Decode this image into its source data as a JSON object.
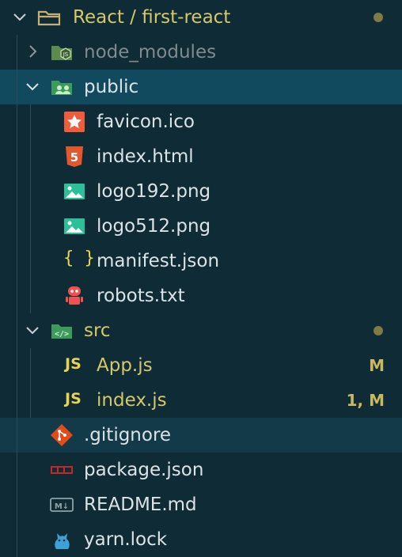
{
  "root": {
    "name": "React / first-react",
    "status": "modified-dot"
  },
  "items": [
    {
      "label": "node_modules",
      "type": "folder",
      "state": "collapsed",
      "style": "ignored"
    },
    {
      "label": "public",
      "type": "folder",
      "state": "expanded",
      "selected": true
    },
    {
      "label": "favicon.ico",
      "type": "file"
    },
    {
      "label": "index.html",
      "type": "file"
    },
    {
      "label": "logo192.png",
      "type": "file"
    },
    {
      "label": "logo512.png",
      "type": "file"
    },
    {
      "label": "manifest.json",
      "type": "file"
    },
    {
      "label": "robots.txt",
      "type": "file"
    },
    {
      "label": "src",
      "type": "folder",
      "state": "expanded",
      "status": "modified-dot"
    },
    {
      "label": "App.js",
      "type": "file",
      "badge": "M"
    },
    {
      "label": "index.js",
      "type": "file",
      "badge": "1, M"
    },
    {
      "label": ".gitignore",
      "type": "file",
      "hover": true
    },
    {
      "label": "package.json",
      "type": "file"
    },
    {
      "label": "README.md",
      "type": "file"
    },
    {
      "label": "yarn.lock",
      "type": "file"
    }
  ],
  "icons": {
    "js_label": "JS",
    "json_label": "{ }",
    "markdown_label": "M↓"
  },
  "colors": {
    "background": "#0f2b36",
    "selected_row": "#114a5e",
    "modified_text": "#d6c86a",
    "folder_green": "#4caf50"
  }
}
